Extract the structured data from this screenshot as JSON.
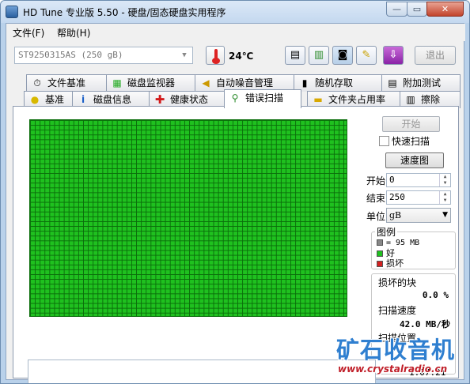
{
  "window": {
    "title": "HD Tune 专业版 5.50 - 硬盘/固态硬盘实用程序",
    "min": "—",
    "max": "▭",
    "close": "✕"
  },
  "menu": {
    "file": "文件(F)",
    "help": "帮助(H)"
  },
  "toolbar": {
    "drive": "ST9250315AS (250 gB)",
    "temperature": "24℃",
    "exit": "退出"
  },
  "tabs_top": [
    "文件基准",
    "磁盘监视器",
    "自动噪音管理",
    "随机存取",
    "附加测试"
  ],
  "tabs_bottom": [
    "基准",
    "磁盘信息",
    "健康状态",
    "错误扫描",
    "文件夹占用率",
    "擦除"
  ],
  "scan": {
    "start_button": "开始",
    "quick_scan": "快速扫描",
    "map_button": "速度图",
    "start_label": "开始",
    "start_value": "0",
    "end_label": "结束",
    "end_value": "250",
    "unit_label": "单位",
    "unit_value": "gB",
    "legend_title": "图例",
    "legend_block": "= 95 MB",
    "legend_good": "好",
    "legend_bad": "损坏",
    "bad_blocks_label": "损坏的块",
    "bad_blocks_value": "0.0 %",
    "speed_label": "扫描速度",
    "speed_value": "42.0 MB/秒",
    "position_label": "扫描位置",
    "elapsed": "1:07:21"
  },
  "colors": {
    "good": "#1fc11f",
    "bad": "#d42020",
    "block": "#888888"
  },
  "watermark": {
    "text": "矿石收音机",
    "url": "www.crystalradio.cn"
  }
}
